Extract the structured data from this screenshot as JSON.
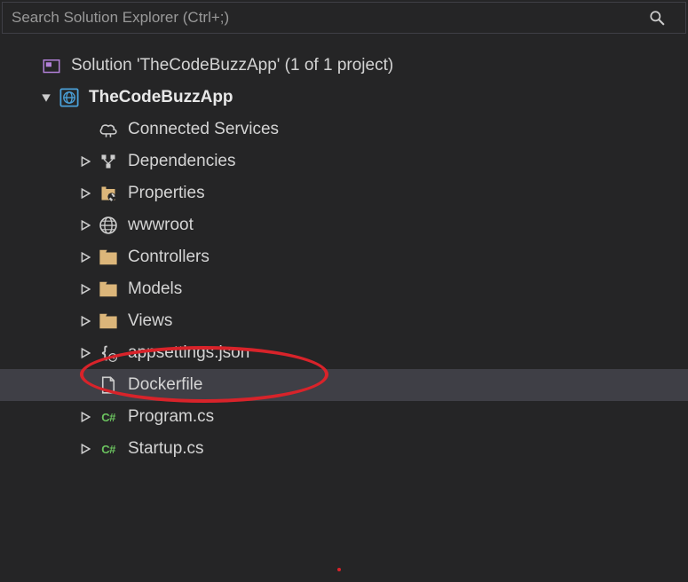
{
  "search": {
    "placeholder": "Search Solution Explorer (Ctrl+;)"
  },
  "solution": {
    "label": "Solution 'TheCodeBuzzApp' (1 of 1 project)"
  },
  "project": {
    "label": "TheCodeBuzzApp"
  },
  "items": [
    {
      "label": "Connected Services",
      "icon": "cloud",
      "expandable": false
    },
    {
      "label": "Dependencies",
      "icon": "deps",
      "expandable": true
    },
    {
      "label": "Properties",
      "icon": "wrench",
      "expandable": true
    },
    {
      "label": "wwwroot",
      "icon": "globe",
      "expandable": true
    },
    {
      "label": "Controllers",
      "icon": "folder",
      "expandable": true
    },
    {
      "label": "Models",
      "icon": "folder",
      "expandable": true
    },
    {
      "label": "Views",
      "icon": "folder",
      "expandable": true
    },
    {
      "label": "appsettings.json",
      "icon": "json",
      "expandable": true
    },
    {
      "label": "Dockerfile",
      "icon": "file",
      "expandable": false,
      "selected": true
    },
    {
      "label": "Program.cs",
      "icon": "cs",
      "expandable": true
    },
    {
      "label": "Startup.cs",
      "icon": "cs",
      "expandable": true
    }
  ]
}
